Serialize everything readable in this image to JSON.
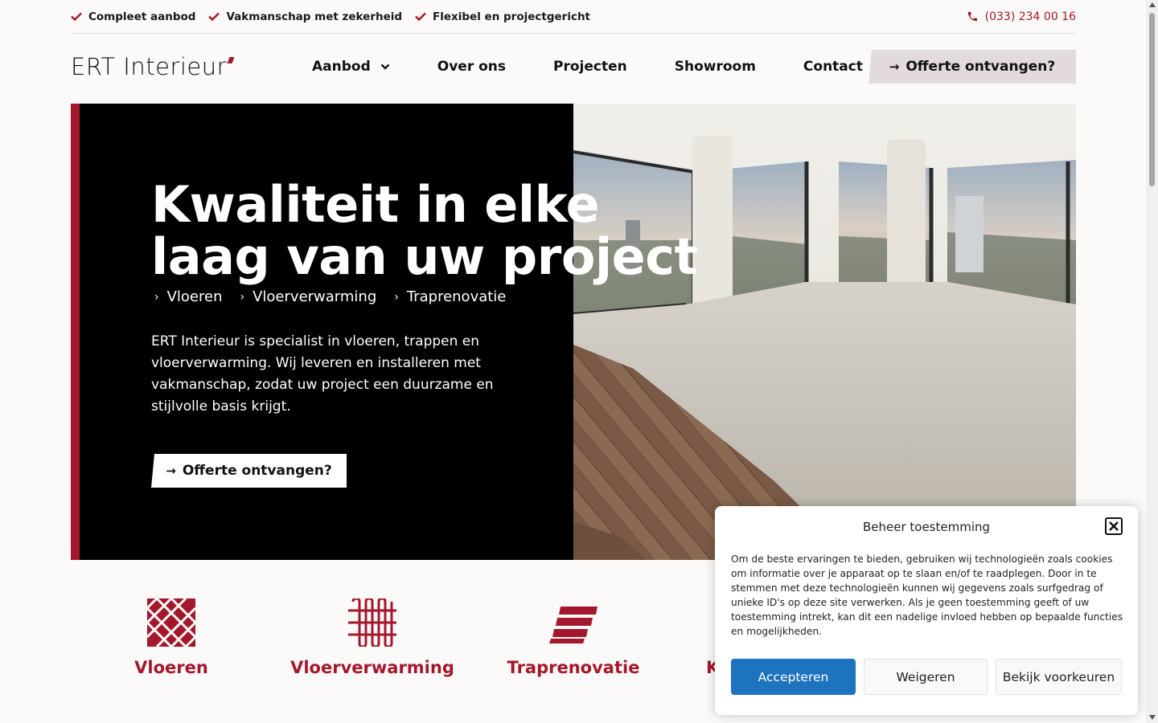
{
  "topbar": {
    "usps": [
      "Compleet aanbod",
      "Vakmanschap met zekerheid",
      "Flexibel en projectgericht"
    ],
    "phone": "(033) 234 00 16"
  },
  "header": {
    "logo": "ERT Interieur",
    "nav": {
      "aanbod": "Aanbod",
      "over_ons": "Over ons",
      "projecten": "Projecten",
      "showroom": "Showroom",
      "contact": "Contact"
    },
    "cta": "Offerte ontvangen?"
  },
  "hero": {
    "title_line1": "Kwaliteit in elke",
    "title_line2": "laag van uw project",
    "links": [
      "Vloeren",
      "Vloerverwarming",
      "Traprenovatie"
    ],
    "text": "ERT Interieur is specialist in vloeren, trappen en vloerverwarming. Wij leveren en installeren met vakmanschap, zodat uw project een duurzame en stijlvolle basis krijgt.",
    "cta": "Offerte ontvangen?"
  },
  "categories": [
    "Vloeren",
    "Vloerverwarming",
    "Traprenovatie",
    "K"
  ],
  "cookie": {
    "title": "Beheer toestemming",
    "body": "Om de beste ervaringen te bieden, gebruiken wij technologieën zoals cookies om informatie over je apparaat op te slaan en/of te raadplegen. Door in te stemmen met deze technologieën kunnen wij gegevens zoals surfgedrag of unieke ID's op deze site verwerken. Als je geen toestemming geeft of uw toestemming intrekt, kan dit een nadelige invloed hebben op bepaalde functies en mogelijkheden.",
    "accept": "Accepteren",
    "deny": "Weigeren",
    "prefs": "Bekijk voorkeuren"
  },
  "colors": {
    "brand_red": "#a3182c",
    "accept_blue": "#1e73be",
    "cta_bg": "#e3dadb",
    "page_bg": "#fcfaf8"
  },
  "icons": {
    "usp": "check-icon",
    "phone": "phone-icon",
    "dropdown": "chevron-down-icon",
    "cta": "arrow-right-icon",
    "hero_links": "chevron-right-icon",
    "close": "close-icon"
  }
}
